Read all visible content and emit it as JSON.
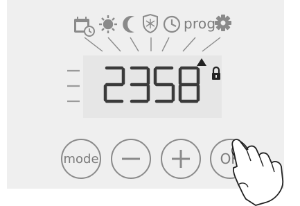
{
  "mode_icons": [
    {
      "name": "calendar-clock-icon",
      "interactable": false
    },
    {
      "name": "sun-icon",
      "interactable": false
    },
    {
      "name": "moon-icon",
      "interactable": false
    },
    {
      "name": "snowflake-shield-icon",
      "interactable": false
    },
    {
      "name": "clock-icon",
      "interactable": false
    },
    {
      "name": "gear-icon",
      "interactable": false
    }
  ],
  "prog_label": "prog",
  "display": {
    "value": "2358",
    "indicators": [
      "up-arrow-icon",
      "lock-icon"
    ],
    "level_bars": 3
  },
  "buttons": {
    "mode_label": "mode",
    "minus_label": "—",
    "plus_label": "+",
    "ok_label": "OK"
  },
  "colors": {
    "panel": "#efefef",
    "icon_gray": "#8a8a8a",
    "lcd_bg": "#e6e6e6",
    "segment": "#3a3a3a"
  }
}
